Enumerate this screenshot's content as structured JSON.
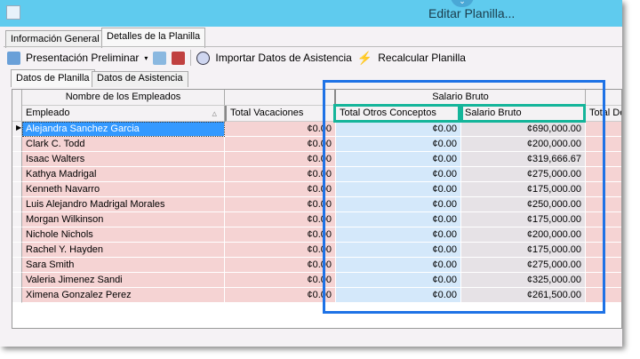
{
  "window": {
    "title": "Editar Planilla...",
    "chevron": "⌄"
  },
  "tabs": [
    {
      "label": "Información General"
    },
    {
      "label": "Detalles de la Planilla",
      "active": true
    }
  ],
  "toolbar": {
    "preview": "Presentación Preliminar",
    "import": "Importar Datos de Asistencia",
    "recalc": "Recalcular Planilla"
  },
  "subtabs": [
    {
      "label": "Datos de Planilla",
      "active": true
    },
    {
      "label": "Datos de Asistencia"
    }
  ],
  "grid": {
    "bands": {
      "names": "Nombre de los Empleados",
      "salary": "Salario Bruto"
    },
    "columns": [
      "Empleado",
      "Total Vacaciones",
      "Total Otros Conceptos",
      "Salario Bruto",
      "Total De"
    ],
    "sort_indicator": "▵",
    "rows": [
      [
        "Alejandra Sanchez Garcia",
        "¢0.00",
        "¢0.00",
        "¢690,000.00"
      ],
      [
        "Clark C. Todd",
        "¢0.00",
        "¢0.00",
        "¢200,000.00"
      ],
      [
        "Isaac Walters",
        "¢0.00",
        "¢0.00",
        "¢319,666.67"
      ],
      [
        "Kathya Madrigal",
        "¢0.00",
        "¢0.00",
        "¢275,000.00"
      ],
      [
        "Kenneth Navarro",
        "¢0.00",
        "¢0.00",
        "¢175,000.00"
      ],
      [
        "Luis Alejandro Madrigal Morales",
        "¢0.00",
        "¢0.00",
        "¢250,000.00"
      ],
      [
        "Morgan Wilkinson",
        "¢0.00",
        "¢0.00",
        "¢175,000.00"
      ],
      [
        "Nichole Nichols",
        "¢0.00",
        "¢0.00",
        "¢200,000.00"
      ],
      [
        "Rachel Y. Hayden",
        "¢0.00",
        "¢0.00",
        "¢175,000.00"
      ],
      [
        "Sara Smith",
        "¢0.00",
        "¢0.00",
        "¢275,000.00"
      ],
      [
        "Valeria Jimenez Sandi",
        "¢0.00",
        "¢0.00",
        "¢325,000.00"
      ],
      [
        "Ximena Gonzalez Perez",
        "¢0.00",
        "¢0.00",
        "¢261,500.00"
      ]
    ],
    "selected_row": 0
  },
  "colors": {
    "titlebar": "#5fcbee",
    "selected": "#3399ff",
    "pink": "#f5d3d3",
    "blue": "#d4e8fa",
    "gray": "#e6e2e6",
    "highlight_box": "#1e72e6",
    "highlight_col": "#14b59a"
  }
}
